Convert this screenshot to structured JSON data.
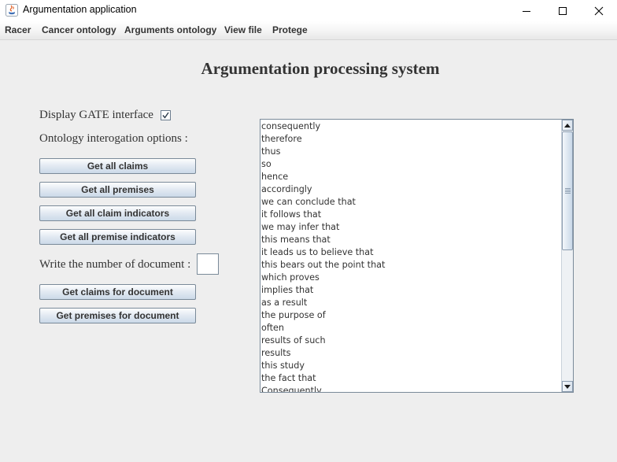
{
  "window": {
    "title": "Argumentation application"
  },
  "menu": [
    {
      "label": "Racer"
    },
    {
      "label": "Cancer ontology"
    },
    {
      "label": "Arguments ontology"
    },
    {
      "label": "View file"
    },
    {
      "label": "Protege"
    }
  ],
  "main": {
    "heading": "Argumentation processing system",
    "display_gate_label": "Display GATE interface",
    "display_gate_checked": true,
    "ontology_options_label": "Ontology interogation options :",
    "buttons": {
      "get_all_claims": "Get all claims",
      "get_all_premises": "Get all premises",
      "get_all_claim_indicators": "Get all claim indicators",
      "get_all_premise_indicators": "Get all premise indicators",
      "get_claims_for_document": "Get claims for document",
      "get_premises_for_document": "Get premises for document"
    },
    "document_number_label": "Write the number of document :",
    "document_number_value": ""
  },
  "results_list": {
    "items": [
      "consequently",
      "therefore",
      "thus",
      "so",
      "hence",
      "accordingly",
      "we can conclude that",
      "it follows that",
      "we may infer that",
      "this means that",
      "it leads us to believe that",
      "this bears out the point that",
      "which proves",
      "implies that",
      "as a result",
      "the purpose of",
      "often",
      "results of such",
      "results",
      "this study",
      "the fact that",
      "Consequently"
    ]
  }
}
